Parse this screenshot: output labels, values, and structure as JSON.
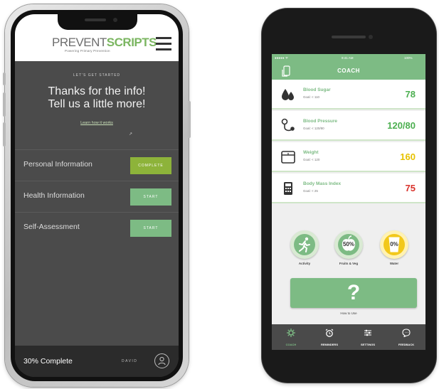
{
  "colors": {
    "brand_green": "#7dbb84",
    "complete_green": "#8db33a",
    "dark_panel": "#4b4b4b",
    "footer_dark": "#2b2b2b",
    "value_green": "#4caf50",
    "value_yellow": "#e7c200",
    "value_red": "#d9322b"
  },
  "phone1": {
    "logo_prefix": "PREVENT",
    "logo_suffix": "SCRIPTS",
    "tagline": "Powering Primary Prevention",
    "menu_icon": "hamburger-icon",
    "kicker": "LET'S GET STARTED",
    "title_line1": "Thanks for the info!",
    "title_line2": "Tell us a little more!",
    "learn_link": "Learn how it works",
    "rows": [
      {
        "label": "Personal Information",
        "action": "COMPLETE",
        "status": "complete"
      },
      {
        "label": "Health Information",
        "action": "START",
        "status": "start"
      },
      {
        "label": "Self-Assessment",
        "action": "START",
        "status": "start"
      }
    ],
    "footer": {
      "progress": "30% Complete",
      "user": "DAVID",
      "avatar_icon": "user-icon"
    }
  },
  "phone2": {
    "status_bar": {
      "left": "●●●●● ᯤ",
      "center": "9:41 AM",
      "right": "100%"
    },
    "header_title": "COACH",
    "back_icon": "phone-back-icon",
    "metrics": [
      {
        "name": "Blood Sugar",
        "goal": "Goal: < 110",
        "value": "78",
        "color": "#4caf50",
        "icon": "blood-drop-icon"
      },
      {
        "name": "Blood Pressure",
        "goal": "Goal: < 120/80",
        "value": "120/80",
        "color": "#4caf50",
        "icon": "stethoscope-icon"
      },
      {
        "name": "Weight",
        "goal": "Goal: < 120",
        "value": "160",
        "color": "#e7c200",
        "icon": "scale-icon"
      },
      {
        "name": "Body Mass Index",
        "goal": "Goal: < 25",
        "value": "75",
        "color": "#d9322b",
        "icon": "calculator-icon"
      }
    ],
    "trackers": [
      {
        "label": "Activity",
        "icon": "runner-icon",
        "fill_text": ""
      },
      {
        "label": "Fruits & Veg",
        "icon": "apple-icon",
        "fill_text": "50%"
      },
      {
        "label": "Water",
        "icon": "glass-icon",
        "fill_text": "0%"
      }
    ],
    "help_button": "?",
    "help_label": "How to Use",
    "nav": [
      {
        "label": "COACH",
        "icon": "gear-icon",
        "active": true
      },
      {
        "label": "REMINDERS",
        "icon": "alarm-clock-icon",
        "active": false
      },
      {
        "label": "SETTINGS",
        "icon": "sliders-icon",
        "active": false
      },
      {
        "label": "FEEDBACK",
        "icon": "chat-bubble-icon",
        "active": false
      }
    ]
  }
}
